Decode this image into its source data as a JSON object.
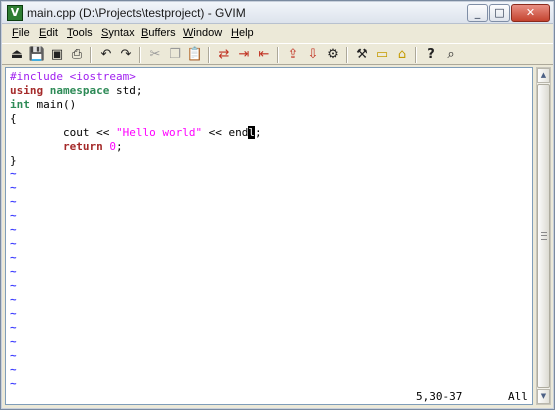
{
  "window": {
    "title": "main.cpp (D:\\Projects\\testproject) - GVIM",
    "app_icon_glyph": "V",
    "caption": {
      "minimize": "_",
      "maximize": "□",
      "close": "✕"
    }
  },
  "menu": [
    {
      "pre": "",
      "acc": "F",
      "post": "ile"
    },
    {
      "pre": "",
      "acc": "E",
      "post": "dit"
    },
    {
      "pre": "",
      "acc": "T",
      "post": "ools"
    },
    {
      "pre": "",
      "acc": "S",
      "post": "yntax"
    },
    {
      "pre": "",
      "acc": "B",
      "post": "uffers"
    },
    {
      "pre": "",
      "acc": "W",
      "post": "indow"
    },
    {
      "pre": "",
      "acc": "H",
      "post": "elp"
    }
  ],
  "toolbar": {
    "icons": [
      {
        "name": "open-icon",
        "glyph": "⏏"
      },
      {
        "name": "save-icon",
        "glyph": "💾"
      },
      {
        "name": "save-all-icon",
        "glyph": "▣"
      },
      {
        "name": "print-icon",
        "glyph": "⎙"
      },
      {
        "name": "undo-icon",
        "glyph": "↶"
      },
      {
        "name": "redo-icon",
        "glyph": "↷"
      },
      {
        "name": "cut-icon",
        "glyph": "✂"
      },
      {
        "name": "copy-icon",
        "glyph": "❐"
      },
      {
        "name": "paste-icon",
        "glyph": "📋"
      },
      {
        "name": "replace-icon",
        "glyph": "⇄"
      },
      {
        "name": "find-next-icon",
        "glyph": "⇥"
      },
      {
        "name": "find-prev-icon",
        "glyph": "⇤"
      },
      {
        "name": "load-session-icon",
        "glyph": "⇪"
      },
      {
        "name": "save-session-icon",
        "glyph": "⇩"
      },
      {
        "name": "run-script-icon",
        "glyph": "⚙"
      },
      {
        "name": "make-icon",
        "glyph": "⚒"
      },
      {
        "name": "shell-icon",
        "glyph": "▭"
      },
      {
        "name": "make-tags-icon",
        "glyph": "⌂"
      },
      {
        "name": "help-icon",
        "glyph": "?"
      },
      {
        "name": "find-help-icon",
        "glyph": "⌕"
      }
    ]
  },
  "editor": {
    "lines": {
      "l1_pre": "#include <iostream>",
      "l2_a": "using",
      "l2_b": "namespace",
      "l2_c": " std;",
      "l3_a": "int",
      "l3_b": " main()",
      "l4": "{",
      "l5_a": "        cout << ",
      "l5_str": "\"Hello world\"",
      "l5_b": " << end",
      "l5_cursor": "l",
      "l5_c": ";",
      "l6_indent": "        ",
      "l6_kw": "return",
      "l6_sp": " ",
      "l6_num": "0",
      "l6_end": ";",
      "l7": "}"
    },
    "tilde_glyph": "~",
    "tilde_count": 16,
    "status": {
      "position": "5,30-37",
      "scroll": "All"
    }
  },
  "scrollbar": {
    "up": "▲",
    "down": "▼"
  }
}
